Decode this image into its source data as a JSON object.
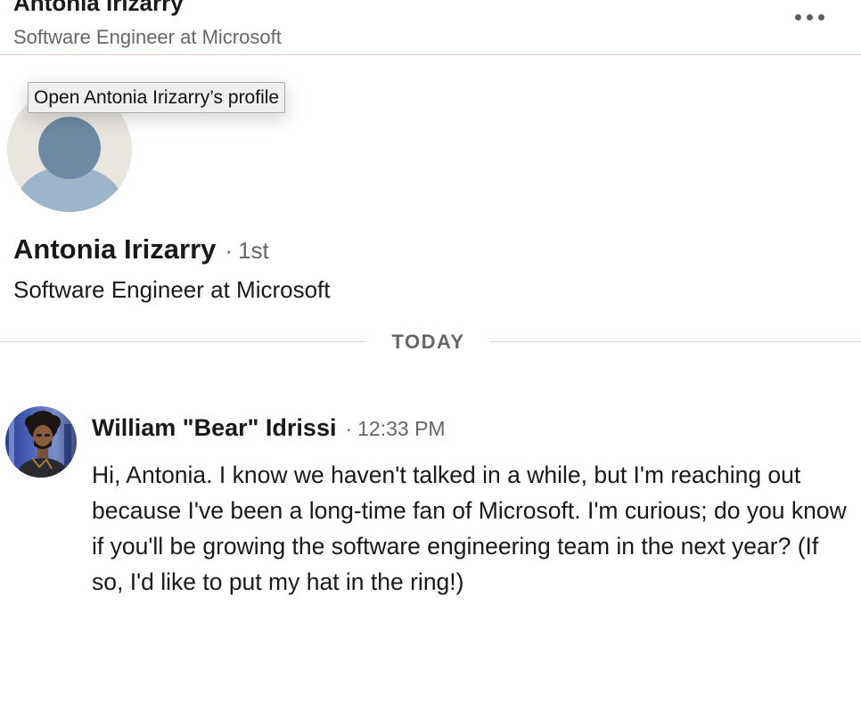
{
  "header": {
    "name": "Antonia Irizarry",
    "headline": "Software Engineer at Microsoft",
    "more_icon": "ellipsis-horizontal-icon"
  },
  "tooltip": {
    "text": "Open Antonia Irizarry’s profile"
  },
  "profile": {
    "name": "Antonia Irizarry",
    "separator": "·",
    "degree": "1st",
    "headline": "Software Engineer at Microsoft",
    "avatar_icon": "default-person-avatar-icon"
  },
  "divider": {
    "label": "TODAY"
  },
  "message": {
    "sender": "William \"Bear\" Idrissi",
    "separator": "·",
    "time": "12:33 PM",
    "body": "Hi, Antonia. I know we haven't talked in a while, but I'm reaching out because I've been a long-time fan of Microsoft. I'm curious; do you know if you'll be growing the software engineering team in the next year? (If so, I'd like to put my hat in the ring!)",
    "avatar_icon": "user-photo-avatar"
  },
  "colors": {
    "text_primary": "#191919",
    "text_secondary": "#666666",
    "header_border": "#e2cbc0",
    "divider": "#d6d6d6",
    "avatar_placeholder_bg": "#e9e5df",
    "avatar_placeholder_head": "#6f8aa5",
    "avatar_placeholder_body": "#9db4c9"
  }
}
